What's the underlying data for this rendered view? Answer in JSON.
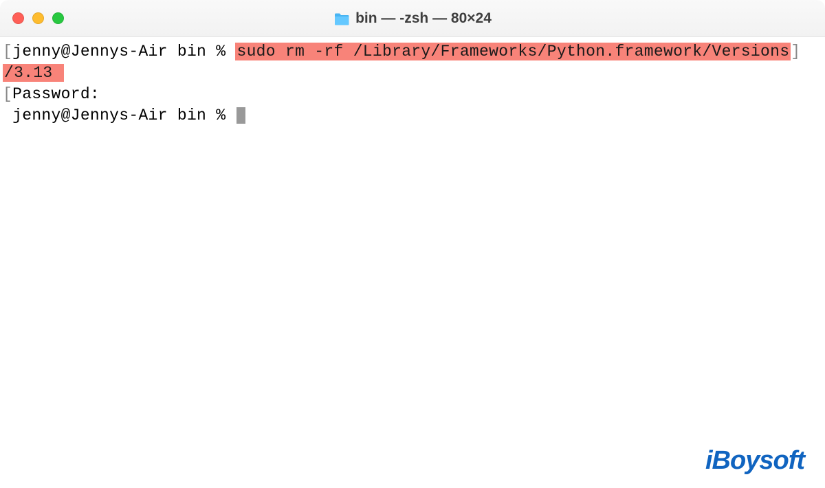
{
  "titlebar": {
    "title": "bin — -zsh — 80×24"
  },
  "terminal": {
    "line1_prompt": "jenny@Jennys-Air bin % ",
    "line1_cmd_part1": "sudo rm -rf /Library/Frameworks/Python.framework/Versions",
    "line2_cmd_part2": "/3.13 ",
    "line3_password": "Password:",
    "line4_prompt": "jenny@Jennys-Air bin % "
  },
  "watermark": {
    "text": "iBoysoft"
  },
  "colors": {
    "highlight_bg": "#f88379",
    "traffic_close": "#ff5f57",
    "traffic_min": "#febc2e",
    "traffic_max": "#28c840",
    "watermark": "#1064c0"
  }
}
